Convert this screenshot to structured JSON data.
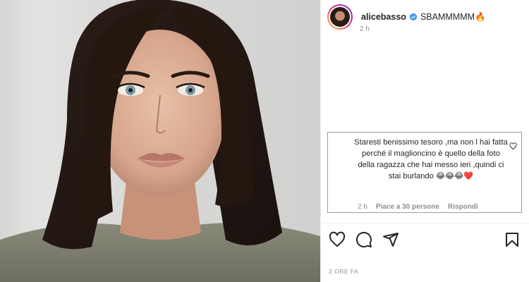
{
  "post": {
    "username": "alicebasso",
    "caption": "SBAMMMMM🔥",
    "time_ago": "2 h",
    "date_label": "2 ORE FA"
  },
  "comment": {
    "text": "Staresti benissimo tesoro ,ma non l hai fatta perché il maglioncino è quello della foto della ragazza che hai messo ieri ,quindi ci stai burlando 😂😂😂❤️",
    "time": "2 h",
    "likes": "Piace a 30 persone",
    "reply_label": "Rispondi"
  },
  "icons": {
    "like": "heart-icon",
    "comment": "comment-bubble-icon",
    "share": "paper-plane-icon",
    "save": "bookmark-icon",
    "verified": "verified-badge-icon"
  },
  "colors": {
    "verified": "#3897f0",
    "muted_text": "#8e8e8e",
    "primary_text": "#262626"
  }
}
